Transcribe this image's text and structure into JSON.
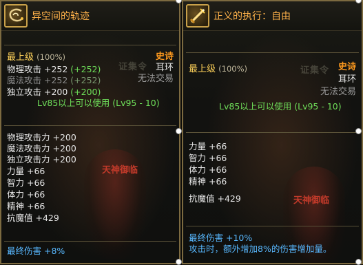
{
  "tooltips": [
    {
      "name": "异空间的轨迹",
      "icon": "whip-icon",
      "grade": "最上级",
      "grade_pct": "(100%)",
      "rarity": "史诗",
      "slot": "耳环",
      "trade": "无法交易",
      "level_req": "Lv85以上可以使用 (Lv95 - 10)",
      "attack_stats": [
        {
          "label": "物理攻击 +252",
          "bonus": "(+252)"
        },
        {
          "label": "魔法攻击 +252",
          "bonus": "(+252)"
        },
        {
          "label": "独立攻击 +200",
          "bonus": "(+200)"
        }
      ],
      "stats": [
        "物理攻击力 +200",
        "魔法攻击力 +200",
        "独立攻击力 +200",
        "力量 +66",
        "智力 +66",
        "体力 +66",
        "精神 +66",
        "抗魔值 +429"
      ],
      "final_damage": "最终伤害 +8%",
      "background_deity": "天神御临"
    },
    {
      "name": "正义的执行：自由",
      "icon": "sword-icon",
      "grade": "最上级",
      "grade_pct": "(100%)",
      "rarity": "史诗",
      "slot": "耳环",
      "trade": "无法交易",
      "level_req": "Lv85以上可以使用 (Lv95 - 10)",
      "stats": [
        "力量 +66",
        "智力 +66",
        "体力 +66",
        "精神 +66",
        "抗魔值 +429"
      ],
      "final_damage": "最终伤害 +10%",
      "effect": "攻击时，额外增加8%的伤害增加量。",
      "background_deity": "天神御临"
    }
  ],
  "watermark": "证集令",
  "colors": {
    "rarity_epic": "#ff9a1e",
    "name": "#ffb24a",
    "bonus_green": "#6fe05a",
    "final_blue": "#58b8ff",
    "border": "#7c6a40"
  }
}
